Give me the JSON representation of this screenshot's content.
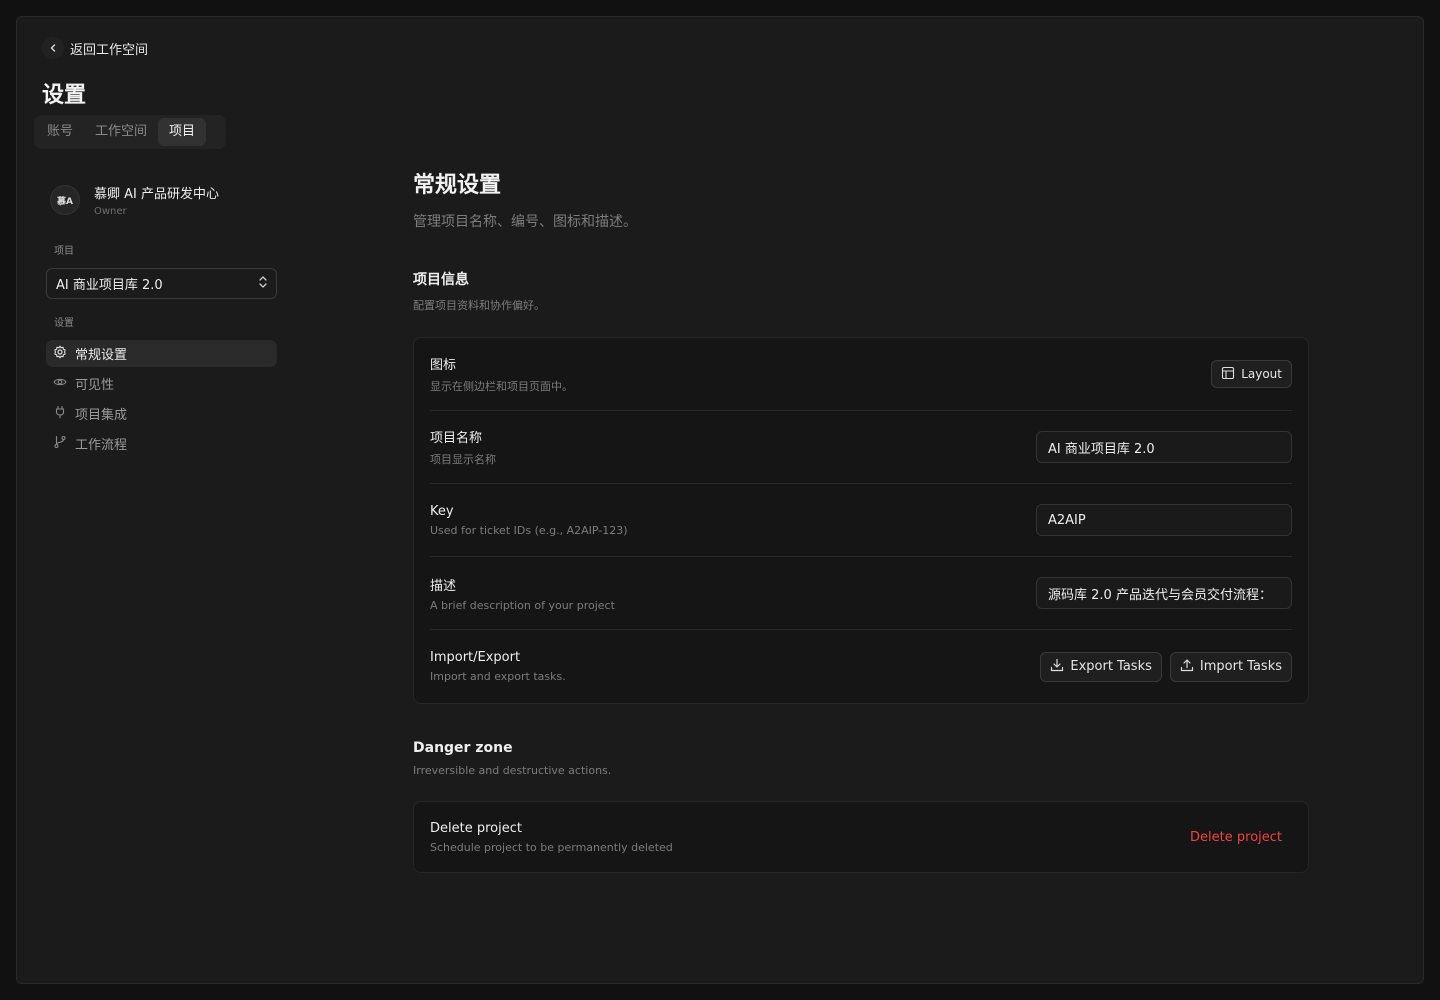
{
  "nav_back": {
    "label": "返回工作空间"
  },
  "page": {
    "title": "设置"
  },
  "tabs": [
    {
      "label": "账号",
      "active": false
    },
    {
      "label": "工作空间",
      "active": false
    },
    {
      "label": "项目",
      "active": true
    }
  ],
  "org": {
    "avatar": "慕A",
    "name": "慕卿 AI 产品研发中心",
    "role": "Owner"
  },
  "sidebar": {
    "project_label": "项目",
    "project_select": "AI 商业项目库 2.0",
    "settings_label": "设置",
    "items": [
      {
        "label": "常规设置",
        "icon": "gear-icon",
        "active": true
      },
      {
        "label": "可见性",
        "icon": "eye-icon",
        "active": false
      },
      {
        "label": "项目集成",
        "icon": "plug-icon",
        "active": false
      },
      {
        "label": "工作流程",
        "icon": "git-branch-icon",
        "active": false
      }
    ]
  },
  "main": {
    "title": "常规设置",
    "subtitle": "管理项目名称、编号、图标和描述。",
    "section_title": "项目信息",
    "section_desc": "配置项目资料和协作偏好。",
    "rows": {
      "icon": {
        "title": "图标",
        "desc": "显示在侧边栏和项目页面中。",
        "button": "Layout"
      },
      "name": {
        "title": "项目名称",
        "desc": "项目显示名称",
        "value": "AI 商业项目库 2.0"
      },
      "key": {
        "title": "Key",
        "desc": "Used for ticket IDs (e.g., A2AIP-123)",
        "value": "A2AIP"
      },
      "description": {
        "title": "描述",
        "desc": "A brief description of your project",
        "value": "源码库 2.0 产品迭代与会员交付流程："
      },
      "import_export": {
        "title": "Import/Export",
        "desc": "Import and export tasks.",
        "export_button": "Export Tasks",
        "import_button": "Import Tasks"
      }
    },
    "danger": {
      "title": "Danger zone",
      "desc": "Irreversible and destructive actions.",
      "row_title": "Delete project",
      "row_desc": "Schedule project to be permanently deleted",
      "button": "Delete project"
    }
  },
  "colors": {
    "background": "#1b1b1b",
    "danger": "#ef4444",
    "text": "#e8e8e8",
    "muted": "#7c7c7c"
  }
}
